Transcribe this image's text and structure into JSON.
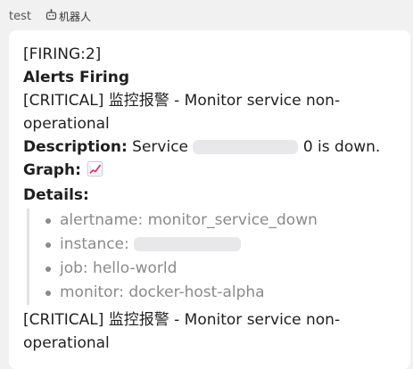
{
  "header": {
    "sender": "test",
    "bot_label": "机器人",
    "bot_icon": "robot-icon"
  },
  "message": {
    "firing_count": "[FIRING:2]",
    "title": "Alerts Firing",
    "alert1": "[CRITICAL] 监控报警 - Monitor service non-operational",
    "description_label": "Description:",
    "description_prefix": "Service",
    "description_suffix": "0 is down.",
    "graph_label": "Graph:",
    "graph_icon": "chart-increasing-icon",
    "details_label": "Details:",
    "details": [
      "alertname: monitor_service_down",
      "instance:",
      "job: hello-world",
      "monitor: docker-host-alpha"
    ],
    "alert2": "[CRITICAL] 监控报警 - Monitor service non-operational"
  },
  "colors": {
    "background": "#f1f1f1",
    "bubble": "#ffffff",
    "details_text": "#8a8a8a",
    "quote_bar": "#e3e3e3"
  }
}
